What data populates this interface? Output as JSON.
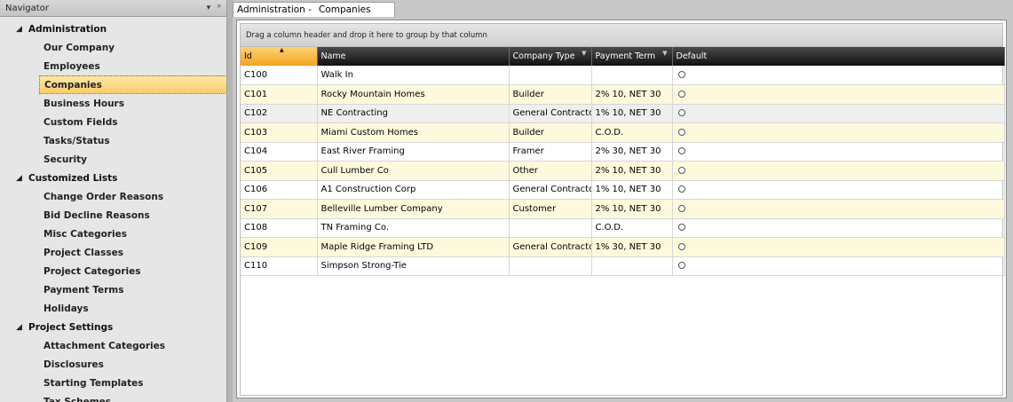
{
  "navigator": {
    "title": "Navigator",
    "dropdown_glyph": "▾",
    "pin_glyph": "ᵖ",
    "groups": [
      {
        "label": "Administration",
        "items": [
          "Our Company",
          "Employees",
          "Companies",
          "Business Hours",
          "Custom Fields",
          "Tasks/Status",
          "Security"
        ]
      },
      {
        "label": "Customized Lists",
        "items": [
          "Change Order Reasons",
          "Bid Decline Reasons",
          "Misc Categories",
          "Project Classes",
          "Project Categories",
          "Payment Terms",
          "Holidays"
        ]
      },
      {
        "label": "Project Settings",
        "items": [
          "Attachment Categories",
          "Disclosures",
          "Starting Templates",
          "Tax Schemes"
        ]
      }
    ],
    "selected": "Companies"
  },
  "document": {
    "tab_prefix": "Administration -",
    "tab_title": "Companies"
  },
  "grid": {
    "group_hint": "Drag a column header and drop it here to group by that column",
    "columns": [
      "Id",
      "Name",
      "Company Type",
      "Payment Term",
      "Default"
    ],
    "rows": [
      {
        "id": "C100",
        "name": "Walk In",
        "type": "",
        "term": ""
      },
      {
        "id": "C101",
        "name": "Rocky Mountain Homes",
        "type": "Builder",
        "term": "2% 10, NET 30"
      },
      {
        "id": "C102",
        "name": "NE Contracting",
        "type": "General Contractor",
        "term": "1% 10, NET 30"
      },
      {
        "id": "C103",
        "name": "Miami Custom Homes",
        "type": "Builder",
        "term": "C.O.D."
      },
      {
        "id": "C104",
        "name": "East River Framing",
        "type": "Framer",
        "term": "2% 30, NET 30"
      },
      {
        "id": "C105",
        "name": "Cull Lumber Co",
        "type": "Other",
        "term": "2% 10, NET 30"
      },
      {
        "id": "C106",
        "name": "A1 Construction Corp",
        "type": "General Contractor",
        "term": "1% 10, NET 30"
      },
      {
        "id": "C107",
        "name": "Belleville Lumber Company",
        "type": "Customer",
        "term": "2% 10, NET 30"
      },
      {
        "id": "C108",
        "name": "TN Framing Co.",
        "type": "",
        "term": "C.O.D."
      },
      {
        "id": "C109",
        "name": "Maple Ridge Framing LTD",
        "type": "General Contractor",
        "term": "1% 30, NET 30"
      },
      {
        "id": "C110",
        "name": "Simpson Strong-Tie",
        "type": "",
        "term": ""
      }
    ]
  }
}
